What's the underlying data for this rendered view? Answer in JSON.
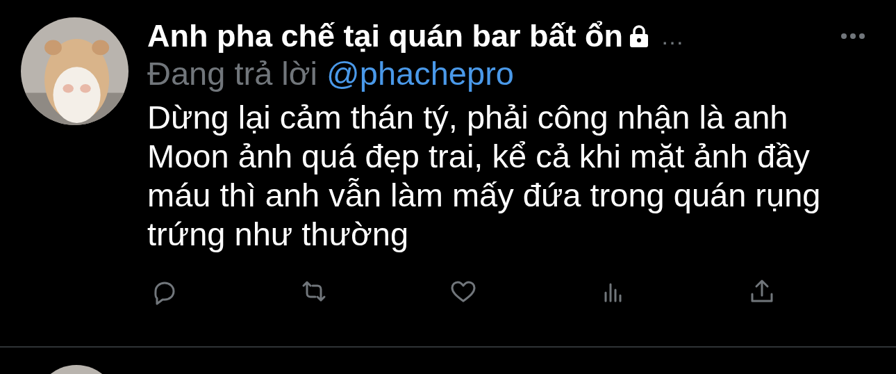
{
  "tweet": {
    "author": "Anh pha chế tại quán bar bất ổn",
    "protected": true,
    "truncation": "…",
    "reply_prefix": "Đang trả lời",
    "reply_to": "@phachepro",
    "text": "Dừng lại cảm thán tý, phải công nhận là anh Moon ảnh quá đẹp trai, kể cả khi mặt ảnh đầy máu thì anh vẫn làm mấy đứa trong quán rụng trứng như thường",
    "actions": [
      {
        "kind": "reply"
      },
      {
        "kind": "retweet"
      },
      {
        "kind": "like"
      },
      {
        "kind": "views"
      },
      {
        "kind": "share"
      }
    ]
  }
}
